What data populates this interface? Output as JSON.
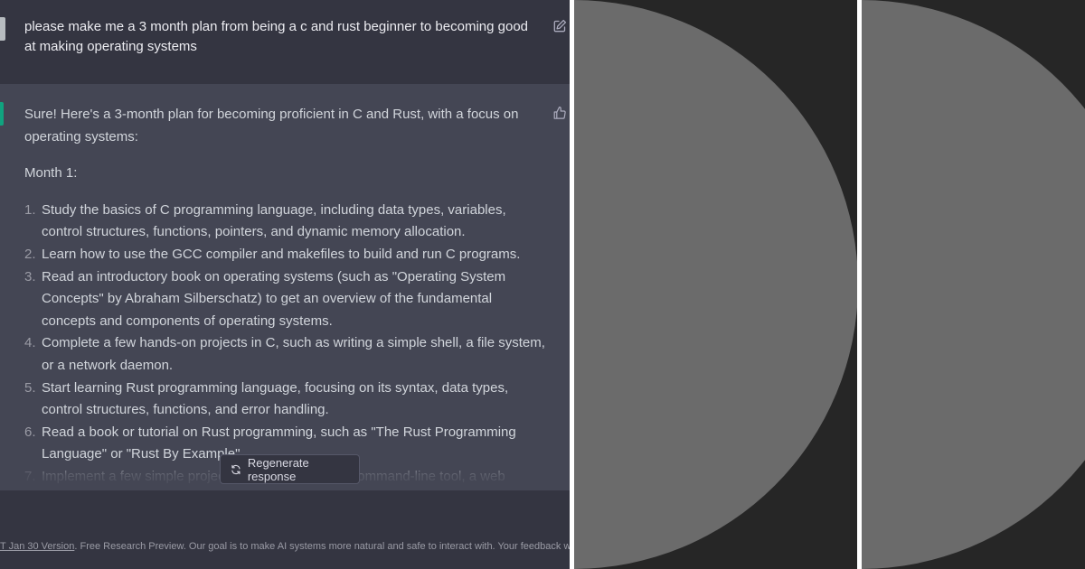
{
  "user_message": {
    "text": "please make me a 3 month plan from being a c and rust beginner to becoming good at making operating systems"
  },
  "assistant_message": {
    "intro": "Sure! Here's a 3-month plan for becoming proficient in C and Rust, with a focus on operating systems:",
    "month_heading": "Month 1:",
    "items": [
      {
        "num": "1.",
        "text": "Study the basics of C programming language, including data types, variables, control structures, functions, pointers, and dynamic memory allocation."
      },
      {
        "num": "2.",
        "text": "Learn how to use the GCC compiler and makefiles to build and run C programs."
      },
      {
        "num": "3.",
        "text": "Read an introductory book on operating systems (such as \"Operating System Concepts\" by Abraham Silberschatz) to get an overview of the fundamental concepts and components of operating systems."
      },
      {
        "num": "4.",
        "text": "Complete a few hands-on projects in C, such as writing a simple shell, a file system, or a network daemon."
      },
      {
        "num": "5.",
        "text": "Start learning Rust programming language, focusing on its syntax, data types, control structures, functions, and error handling."
      },
      {
        "num": "6.",
        "text": "Read a book or tutorial on Rust programming, such as \"The Rust Programming Language\" or \"Rust By Example\"."
      },
      {
        "num": "7.",
        "text": "Implement a few simple projects in Rust, such as a command-line tool, a web server, or a"
      }
    ]
  },
  "regenerate": {
    "label": "Regenerate response",
    "icon": "refresh-icon"
  },
  "footer": {
    "link_text": "T Jan 30 Version",
    "text": ". Free Research Preview. Our goal is to make AI systems more natural and safe to interact with. Your feedback will help us"
  },
  "colors": {
    "background": "#343541",
    "assistant_background": "#444654",
    "assistant_avatar": "#10a37f",
    "dark_panel": "#262626",
    "circle": "#6b6b6b"
  }
}
